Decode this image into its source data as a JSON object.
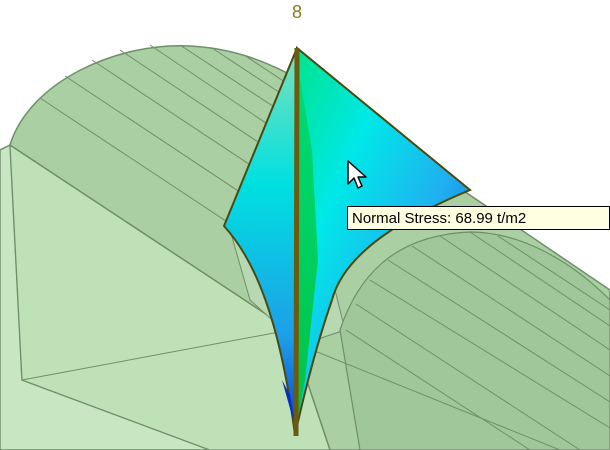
{
  "node_label": "8",
  "tooltip": {
    "label": "Normal Stress:",
    "value": "68.99",
    "unit": "t/m2",
    "text": "Normal Stress: 68.99 t/m2"
  },
  "colors": {
    "mesh_fill": "#b3d6ae",
    "mesh_edge": "#6f8f6a",
    "beam": "#6b5a12",
    "stress_low": "#00c84a",
    "stress_mid": "#00e8e8",
    "stress_high": "#0050d8",
    "tooltip_bg": "#ffffe1"
  },
  "icons": {
    "cursor": "arrow-cursor-icon"
  }
}
